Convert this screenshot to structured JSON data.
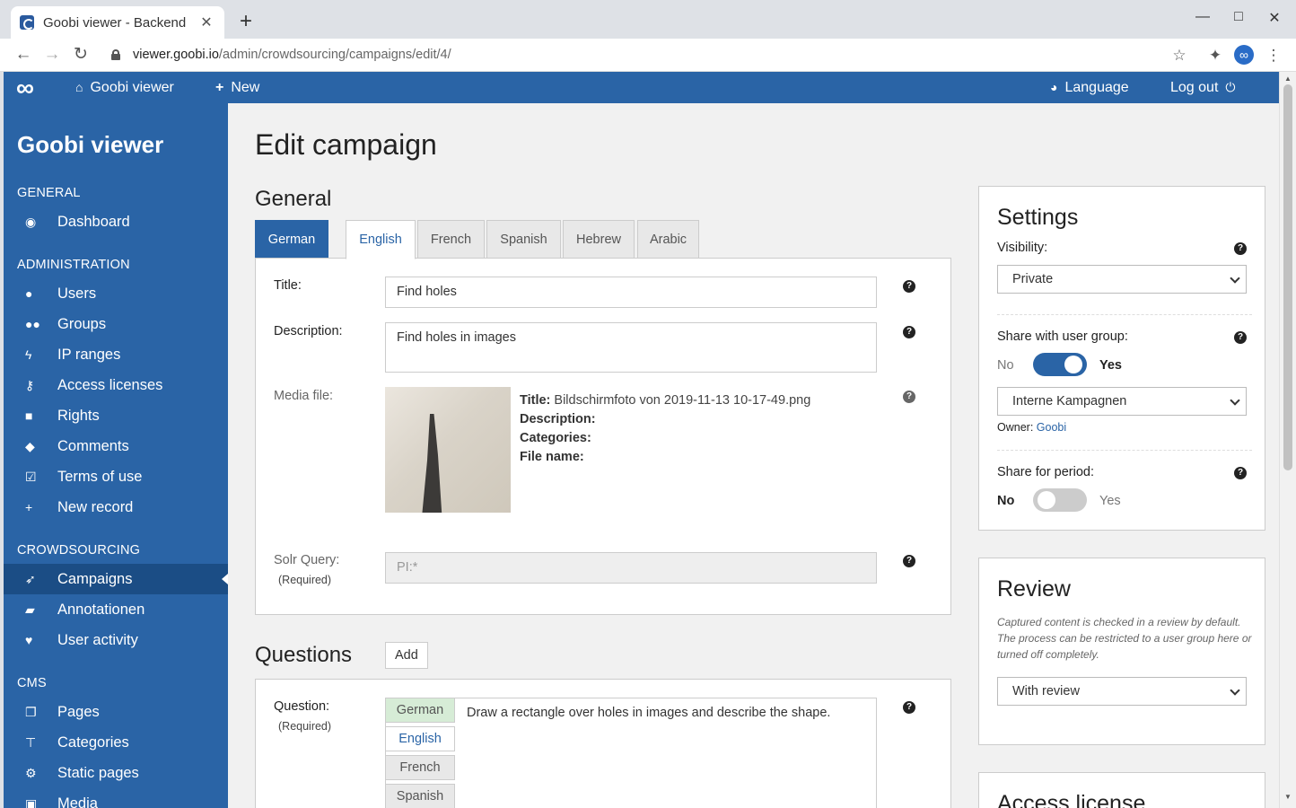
{
  "browser": {
    "tab_title": "Goobi viewer - Backend",
    "tab_close": "✕",
    "new_tab": "+",
    "minimize": "—",
    "maximize": "□",
    "close": "✕",
    "url_domain": "viewer.goobi.io",
    "url_path": "/admin/crowdsourcing/campaigns/edit/4/"
  },
  "header": {
    "logo": "∞",
    "home_label": "Goobi viewer",
    "new_label": "New",
    "language_label": "Language",
    "logout_label": "Log out"
  },
  "sidebar": {
    "brand": "Goobi viewer",
    "sections": {
      "general": "GENERAL",
      "administration": "ADMINISTRATION",
      "crowdsourcing": "CROWDSOURCING",
      "cms": "CMS"
    },
    "items": {
      "dashboard": "Dashboard",
      "users": "Users",
      "groups": "Groups",
      "ip_ranges": "IP ranges",
      "access_licenses": "Access licenses",
      "rights": "Rights",
      "comments": "Comments",
      "terms_of_use": "Terms of use",
      "new_record": "New record",
      "campaigns": "Campaigns",
      "annotationen": "Annotationen",
      "user_activity": "User activity",
      "pages": "Pages",
      "categories": "Categories",
      "static_pages": "Static pages",
      "media": "Media"
    }
  },
  "main": {
    "title": "Edit campaign",
    "general_heading": "General",
    "languages": [
      "German",
      "English",
      "French",
      "Spanish",
      "Hebrew",
      "Arabic"
    ],
    "form": {
      "title_label": "Title:",
      "title_value": "Find holes",
      "description_label": "Description:",
      "description_value": "Find holes in images",
      "media_label": "Media file:",
      "media_title_label": "Title:",
      "media_title_value": "Bildschirmfoto von 2019-11-13 10-17-49.png",
      "media_description_label": "Description:",
      "media_categories_label": "Categories:",
      "media_filename_label": "File name:",
      "solr_label": "Solr Query:",
      "required": "(Required)",
      "solr_value": "PI:*"
    },
    "questions_heading": "Questions",
    "add_label": "Add",
    "question": {
      "label": "Question:",
      "required": "(Required)",
      "languages": [
        "German",
        "English",
        "French",
        "Spanish"
      ],
      "text": "Draw a rectangle over holes in images and describe the shape."
    }
  },
  "settings": {
    "title": "Settings",
    "visibility_label": "Visibility:",
    "visibility_value": "Private",
    "share_group_label": "Share with user group:",
    "no": "No",
    "yes": "Yes",
    "share_group_on": true,
    "group_value": "Interne Kampagnen",
    "owner_label": "Owner:",
    "owner_value": "Goobi",
    "share_period_label": "Share for period:",
    "share_period_on": false
  },
  "review": {
    "title": "Review",
    "note": "Captured content is checked in a review by default. The process can be restricted to a user group here or turned off completely.",
    "value": "With review"
  },
  "access_license": {
    "title": "Access license"
  },
  "colors": {
    "primary": "#2a64a6",
    "sidebar_active": "#1b4d85"
  }
}
